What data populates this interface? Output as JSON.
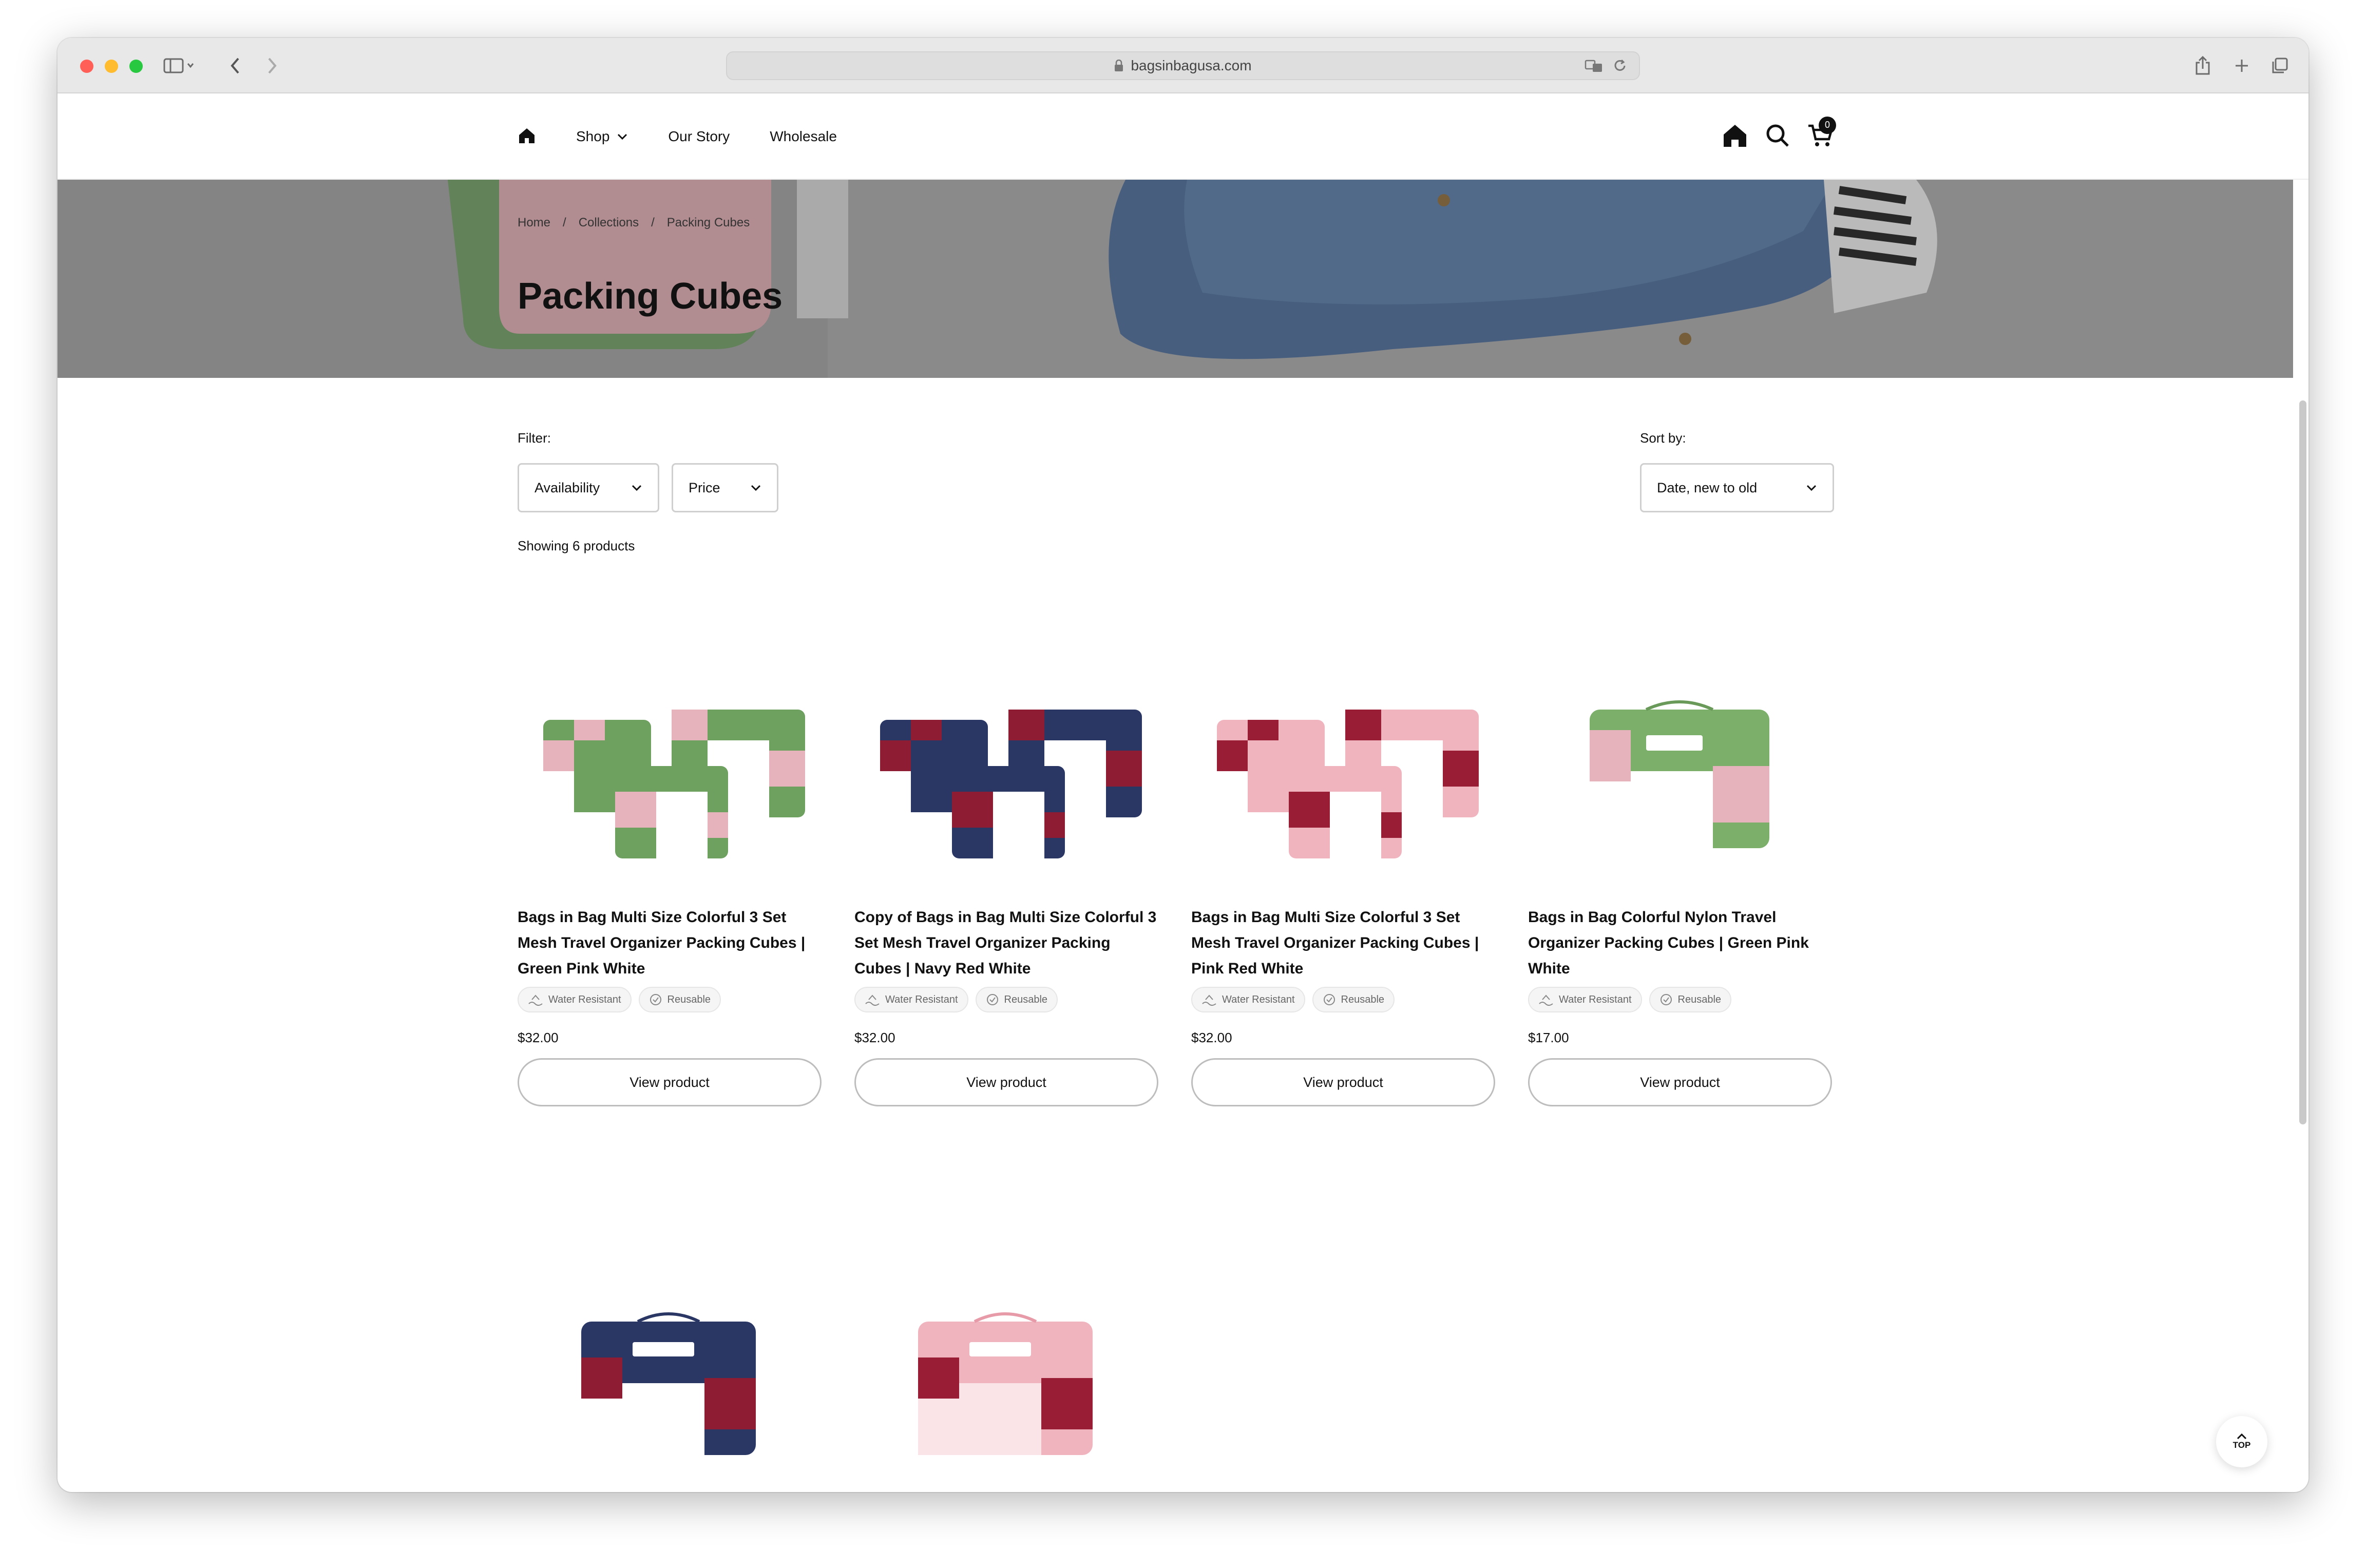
{
  "browser": {
    "url": "bagsinbagusa.com"
  },
  "nav": {
    "links": [
      {
        "label": "Shop"
      },
      {
        "label": "Our Story"
      },
      {
        "label": "Wholesale"
      }
    ],
    "cart_count": "0"
  },
  "hero": {
    "breadcrumb": [
      "Home",
      "/",
      "Collections",
      "/",
      "Packing Cubes"
    ],
    "title": "Packing Cubes"
  },
  "filters": {
    "label": "Filter:",
    "availability": "Availability",
    "price": "Price",
    "sort_label": "Sort by:",
    "sort_value": "Date, new to old",
    "showing": "Showing 6 products"
  },
  "products": [
    {
      "title": "Bags in Bag Multi Size Colorful 3 Set Mesh Travel Organizer Packing Cubes | Green Pink White",
      "badges": [
        "Water Resistant",
        "Reusable"
      ],
      "price": "$32.00",
      "button": "View product",
      "colors": {
        "main": "#6ea05f",
        "accent": "#e6b3bd",
        "third": "#ffffff"
      }
    },
    {
      "title": "Copy of Bags in Bag Multi Size Colorful 3 Set Mesh Travel Organizer Packing Cubes | Navy Red White",
      "badges": [
        "Water Resistant",
        "Reusable"
      ],
      "price": "$32.00",
      "button": "View product",
      "colors": {
        "main": "#2a3764",
        "accent": "#8e1c33",
        "third": "#ffffff"
      }
    },
    {
      "title": "Bags in Bag Multi Size Colorful 3 Set Mesh Travel Organizer Packing Cubes | Pink Red White",
      "badges": [
        "Water Resistant",
        "Reusable"
      ],
      "price": "$32.00",
      "button": "View product",
      "colors": {
        "main": "#f0b4bf",
        "accent": "#9a1d36",
        "third": "#ffffff"
      }
    },
    {
      "title": "Bags in Bag Colorful Nylon Travel Organizer Packing Cubes | Green Pink White",
      "badges": [
        "Water Resistant",
        "Reusable"
      ],
      "price": "$17.00",
      "button": "View product",
      "colors": {
        "main": "#7cb06a",
        "accent": "#e6b3bd",
        "third": "#ffffff"
      }
    },
    {
      "colors": {
        "main": "#2a3764",
        "accent": "#8e1c33",
        "third": "#ffffff"
      }
    },
    {
      "colors": {
        "main": "#f0b4bf",
        "accent": "#9a1d36",
        "third": "#ffffff"
      }
    }
  ],
  "top_button": "TOP"
}
